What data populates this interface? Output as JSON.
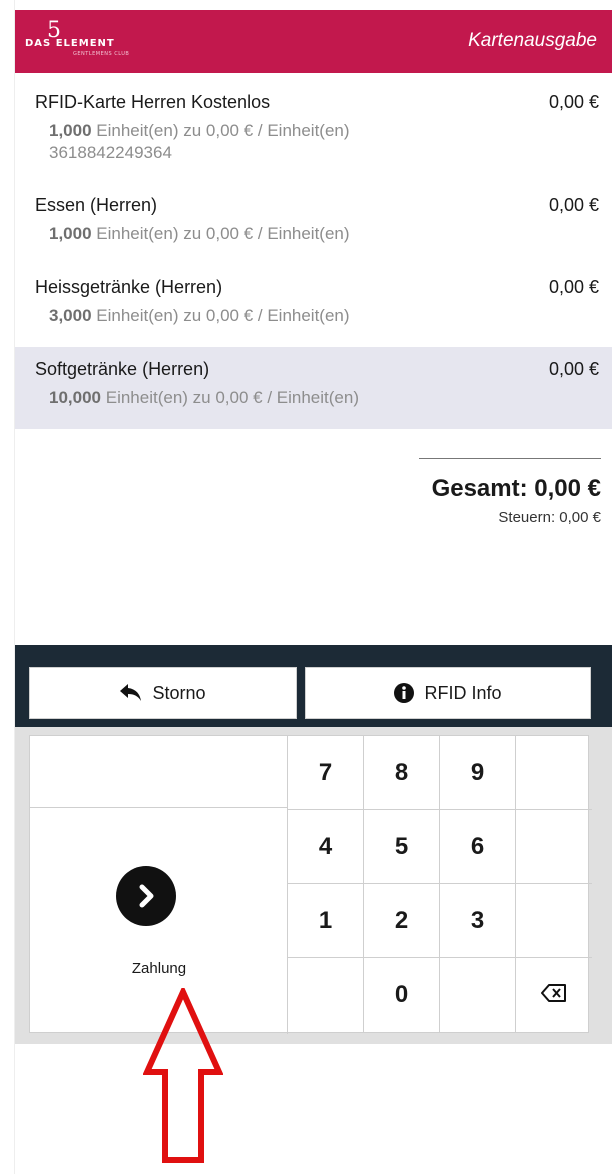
{
  "header": {
    "logo_number": "5",
    "logo_brand": "DAS ELEMENT",
    "logo_sub": "GENTLEMENS CLUB",
    "title": "Kartenausgabe",
    "brand_color": "#c2184d"
  },
  "items": [
    {
      "name": "RFID-Karte Herren Kostenlos",
      "price": "0,00 €",
      "qty": "1,000",
      "unit_text": "Einheit(en) zu 0,00 € / Einheit(en)",
      "code": "3618842249364",
      "selected": false
    },
    {
      "name": "Essen (Herren)",
      "price": "0,00 €",
      "qty": "1,000",
      "unit_text": "Einheit(en) zu 0,00 € / Einheit(en)",
      "selected": false
    },
    {
      "name": "Heissgetränke (Herren)",
      "price": "0,00 €",
      "qty": "3,000",
      "unit_text": "Einheit(en) zu 0,00 € / Einheit(en)",
      "selected": false
    },
    {
      "name": "Softgetränke (Herren)",
      "price": "0,00 €",
      "qty": "10,000",
      "unit_text": "Einheit(en) zu 0,00 € / Einheit(en)",
      "selected": true
    }
  ],
  "totals": {
    "total": "Gesamt: 0,00 €",
    "tax": "Steuern: 0,00 €"
  },
  "controls": {
    "storno_label": "Storno",
    "storno_icon": "reply-arrow-icon",
    "rfid_label": "RFID Info",
    "rfid_icon": "info-circle-icon"
  },
  "numpad": {
    "payment_label": "Zahlung",
    "payment_icon": "chevron-right-circle-icon",
    "keys": [
      "7",
      "8",
      "9",
      "4",
      "5",
      "6",
      "1",
      "2",
      "3",
      "0"
    ],
    "backspace_icon": "backspace-icon"
  },
  "annotation": {
    "arrow_icon": "red-up-arrow-icon",
    "arrow_color": "#e01010"
  }
}
